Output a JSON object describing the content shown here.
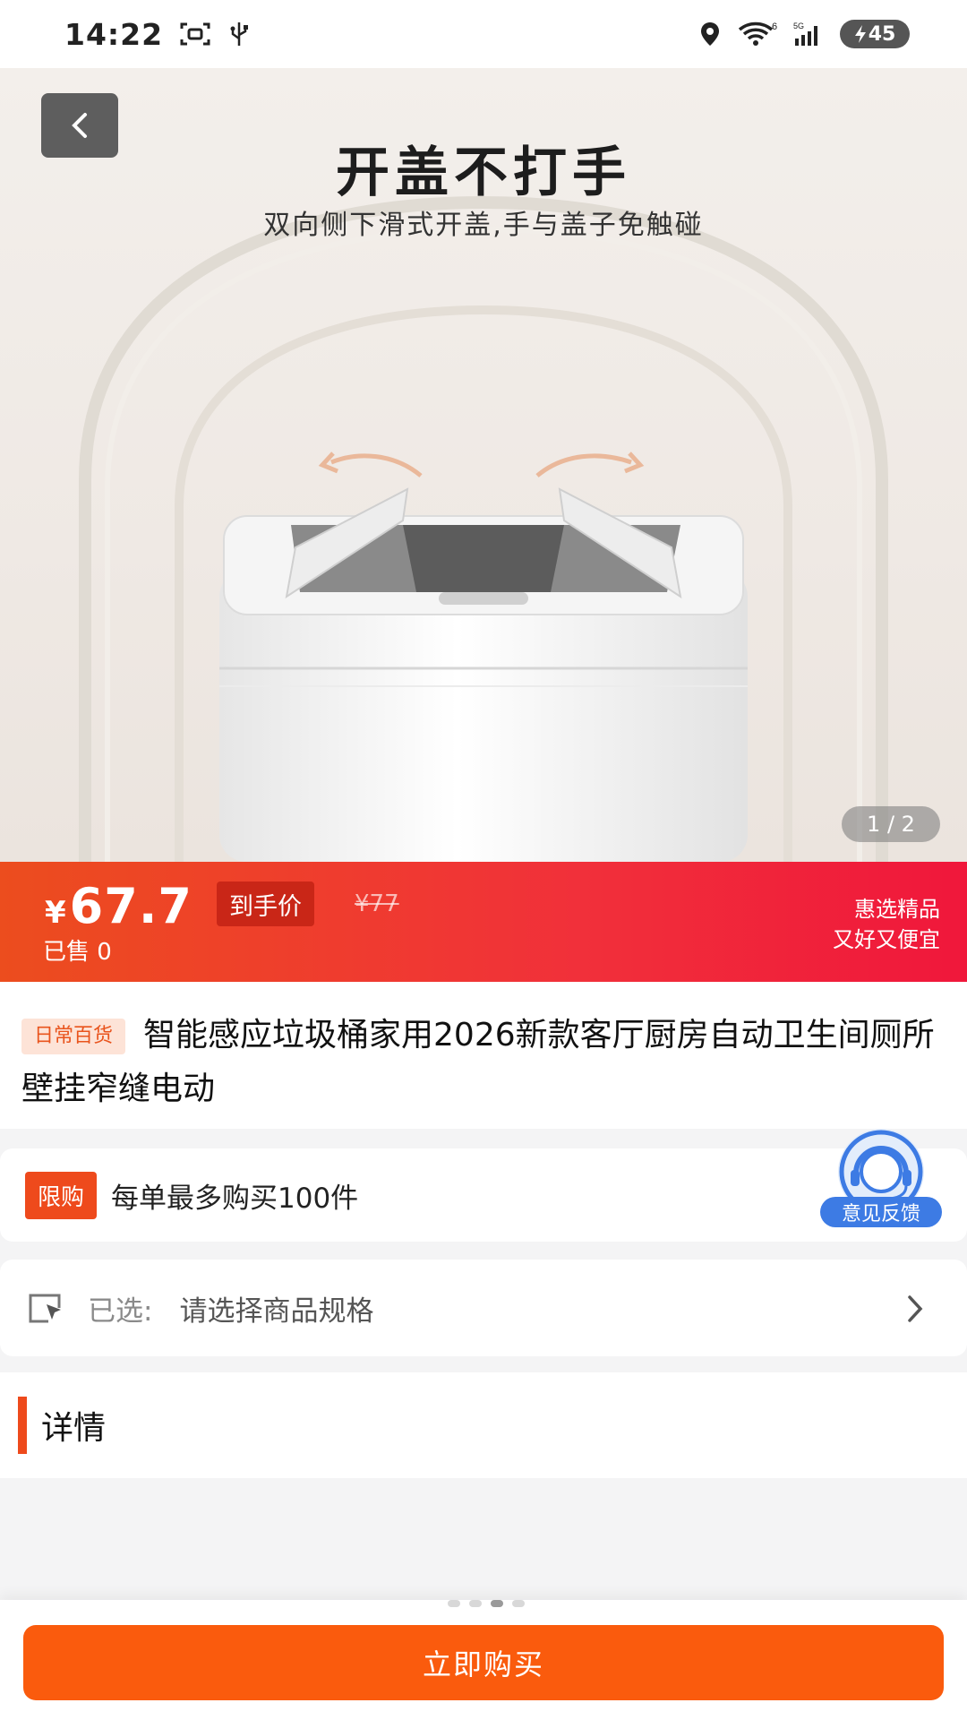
{
  "status_bar": {
    "time": "14:22",
    "battery": "45",
    "icons": [
      "screenshot-icon",
      "usb-icon",
      "location-icon",
      "wifi-icon",
      "signal-icon",
      "battery-charging-icon"
    ]
  },
  "hero": {
    "title": "开盖不打手",
    "subtitle": "双向侧下滑式开盖,手与盖子免触碰",
    "image_counter": "1 / 2"
  },
  "price": {
    "currency": "¥",
    "value": "67.7",
    "final_price_label": "到手价",
    "original_price": "¥77",
    "sold": "已售 0",
    "slogan_line1": "惠选精品",
    "slogan_line2": "又好又便宜"
  },
  "product": {
    "category_tag": "日常百货",
    "title": "智能感应垃圾桶家用2026新款客厅厨房自动卫生间厕所壁挂窄缝电动"
  },
  "limit": {
    "tag": "限购",
    "text": "每单最多购买100件"
  },
  "feedback": {
    "label": "意见反馈"
  },
  "spec": {
    "label": "已选:",
    "value": "请选择商品规格"
  },
  "detail": {
    "title": "详情"
  },
  "bottom": {
    "buy_label": "立即购买"
  },
  "colors": {
    "accent": "#fa5b0d",
    "price_banner_start": "#ec4d1e",
    "price_banner_end": "#f0173b",
    "feedback_blue": "#3d7be4"
  }
}
